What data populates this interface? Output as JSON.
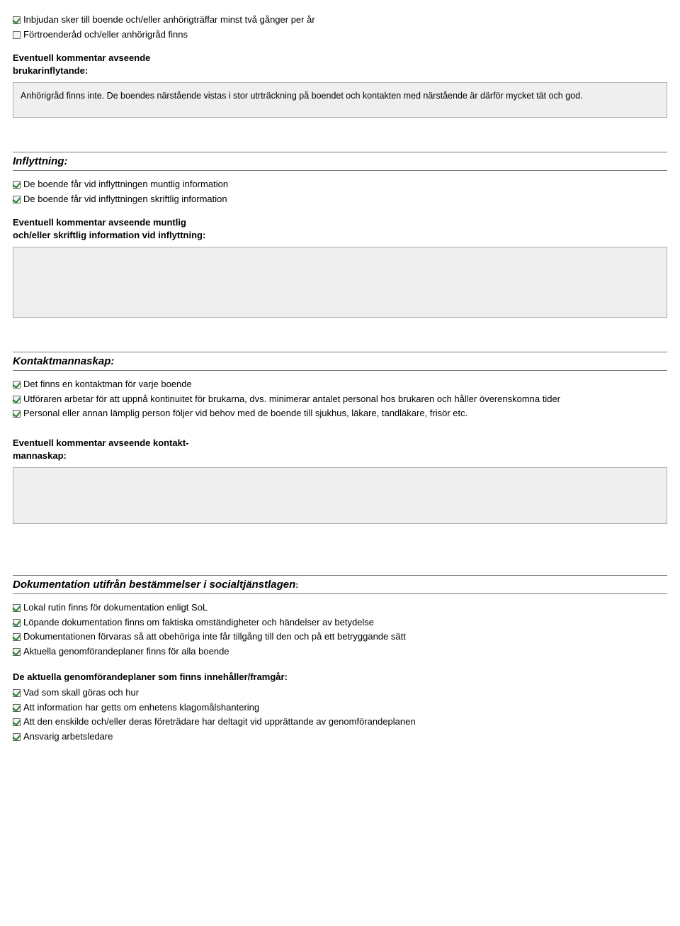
{
  "top": {
    "items": [
      {
        "checked": true,
        "label": "Inbjudan sker till boende och/eller anhörigträffar minst två gånger per år"
      },
      {
        "checked": false,
        "label": "Förtroenderåd och/eller anhörigråd finns"
      }
    ],
    "comment_label_1": "Eventuell kommentar avseende",
    "comment_label_2": "brukarinflytande:",
    "comment_text": "Anhörigråd finns inte. De boendes närstående vistas i stor utrträckning på boendet och kontakten med närstående är därför mycket tät och god."
  },
  "inflyttning": {
    "title": "Inflyttning:",
    "items": [
      {
        "checked": true,
        "label": "De boende får vid inflyttningen muntlig information"
      },
      {
        "checked": true,
        "label": "De boende får vid inflyttningen skriftlig information"
      }
    ],
    "comment_label_1": "Eventuell kommentar avseende muntlig",
    "comment_label_2": "och/eller skriftlig information vid inflyttning:"
  },
  "kontakt": {
    "title": "Kontaktmannaskap:",
    "items": [
      {
        "checked": true,
        "label": "Det finns en kontaktman för varje boende"
      },
      {
        "checked": true,
        "label": "Utföraren arbetar för att uppnå kontinuitet för brukarna, dvs. minimerar antalet personal hos brukaren och håller överenskomna tider"
      },
      {
        "checked": true,
        "label": "Personal eller annan lämplig person följer vid behov med de boende till sjukhus, läkare, tandläkare, frisör etc."
      }
    ],
    "comment_label_1": "Eventuell kommentar avseende kontakt-",
    "comment_label_2": "mannaskap:"
  },
  "dokumentation": {
    "title_main": "Dokumentation utifrån bestämmelser i socialtjänstlagen",
    "title_tail": ":",
    "items": [
      {
        "checked": true,
        "label": "Lokal rutin finns för dokumentation enligt SoL"
      },
      {
        "checked": true,
        "label": "Löpande dokumentation finns om faktiska omständigheter och händelser av betydelse"
      },
      {
        "checked": true,
        "label": "Dokumentationen förvaras så att obehöriga inte får tillgång till den och på ett betryggande sätt"
      },
      {
        "checked": true,
        "label": "Aktuella genomförandeplaner finns för alla boende"
      }
    ],
    "subhead": "De aktuella genomförandeplaner som finns innehåller/framgår:",
    "sub_items": [
      {
        "checked": true,
        "label": "Vad som skall göras och hur"
      },
      {
        "checked": true,
        "label": "Att information har getts om enhetens klagomålshantering"
      },
      {
        "checked": true,
        "label": "Att den enskilde och/eller deras företrädare har deltagit vid upprättande av genomförandeplanen"
      },
      {
        "checked": true,
        "label": "Ansvarig arbetsledare"
      }
    ]
  }
}
